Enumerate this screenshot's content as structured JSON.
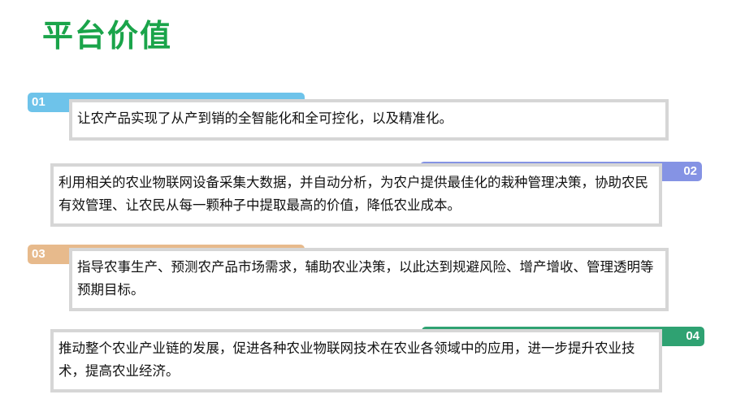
{
  "title": "平台价值",
  "items": [
    {
      "number": "01",
      "text": "让农产品实现了从产到销的全智能化和全可控化，以及精准化。",
      "color": "#6ec3ea"
    },
    {
      "number": "02",
      "text": "利用相关的农业物联网设备采集大数据，并自动分析，为农户提供最佳化的栽种管理决策，协助农民有效管理、让农民从每一颗种子中提取最高的价值，降低农业成本。",
      "color": "#8593e4"
    },
    {
      "number": "03",
      "text": "指导农事生产、预测农产品市场需求，辅助农业决策，以此达到规避风险、增产增收、管理透明等预期目标。",
      "color": "#e7ba8c"
    },
    {
      "number": "04",
      "text": "推动整个农业产业链的发展，促进各种农业物联网技术在农业各领域中的应用，进一步提升农业技术，提高农业经济。",
      "color": "#2fa272"
    }
  ]
}
